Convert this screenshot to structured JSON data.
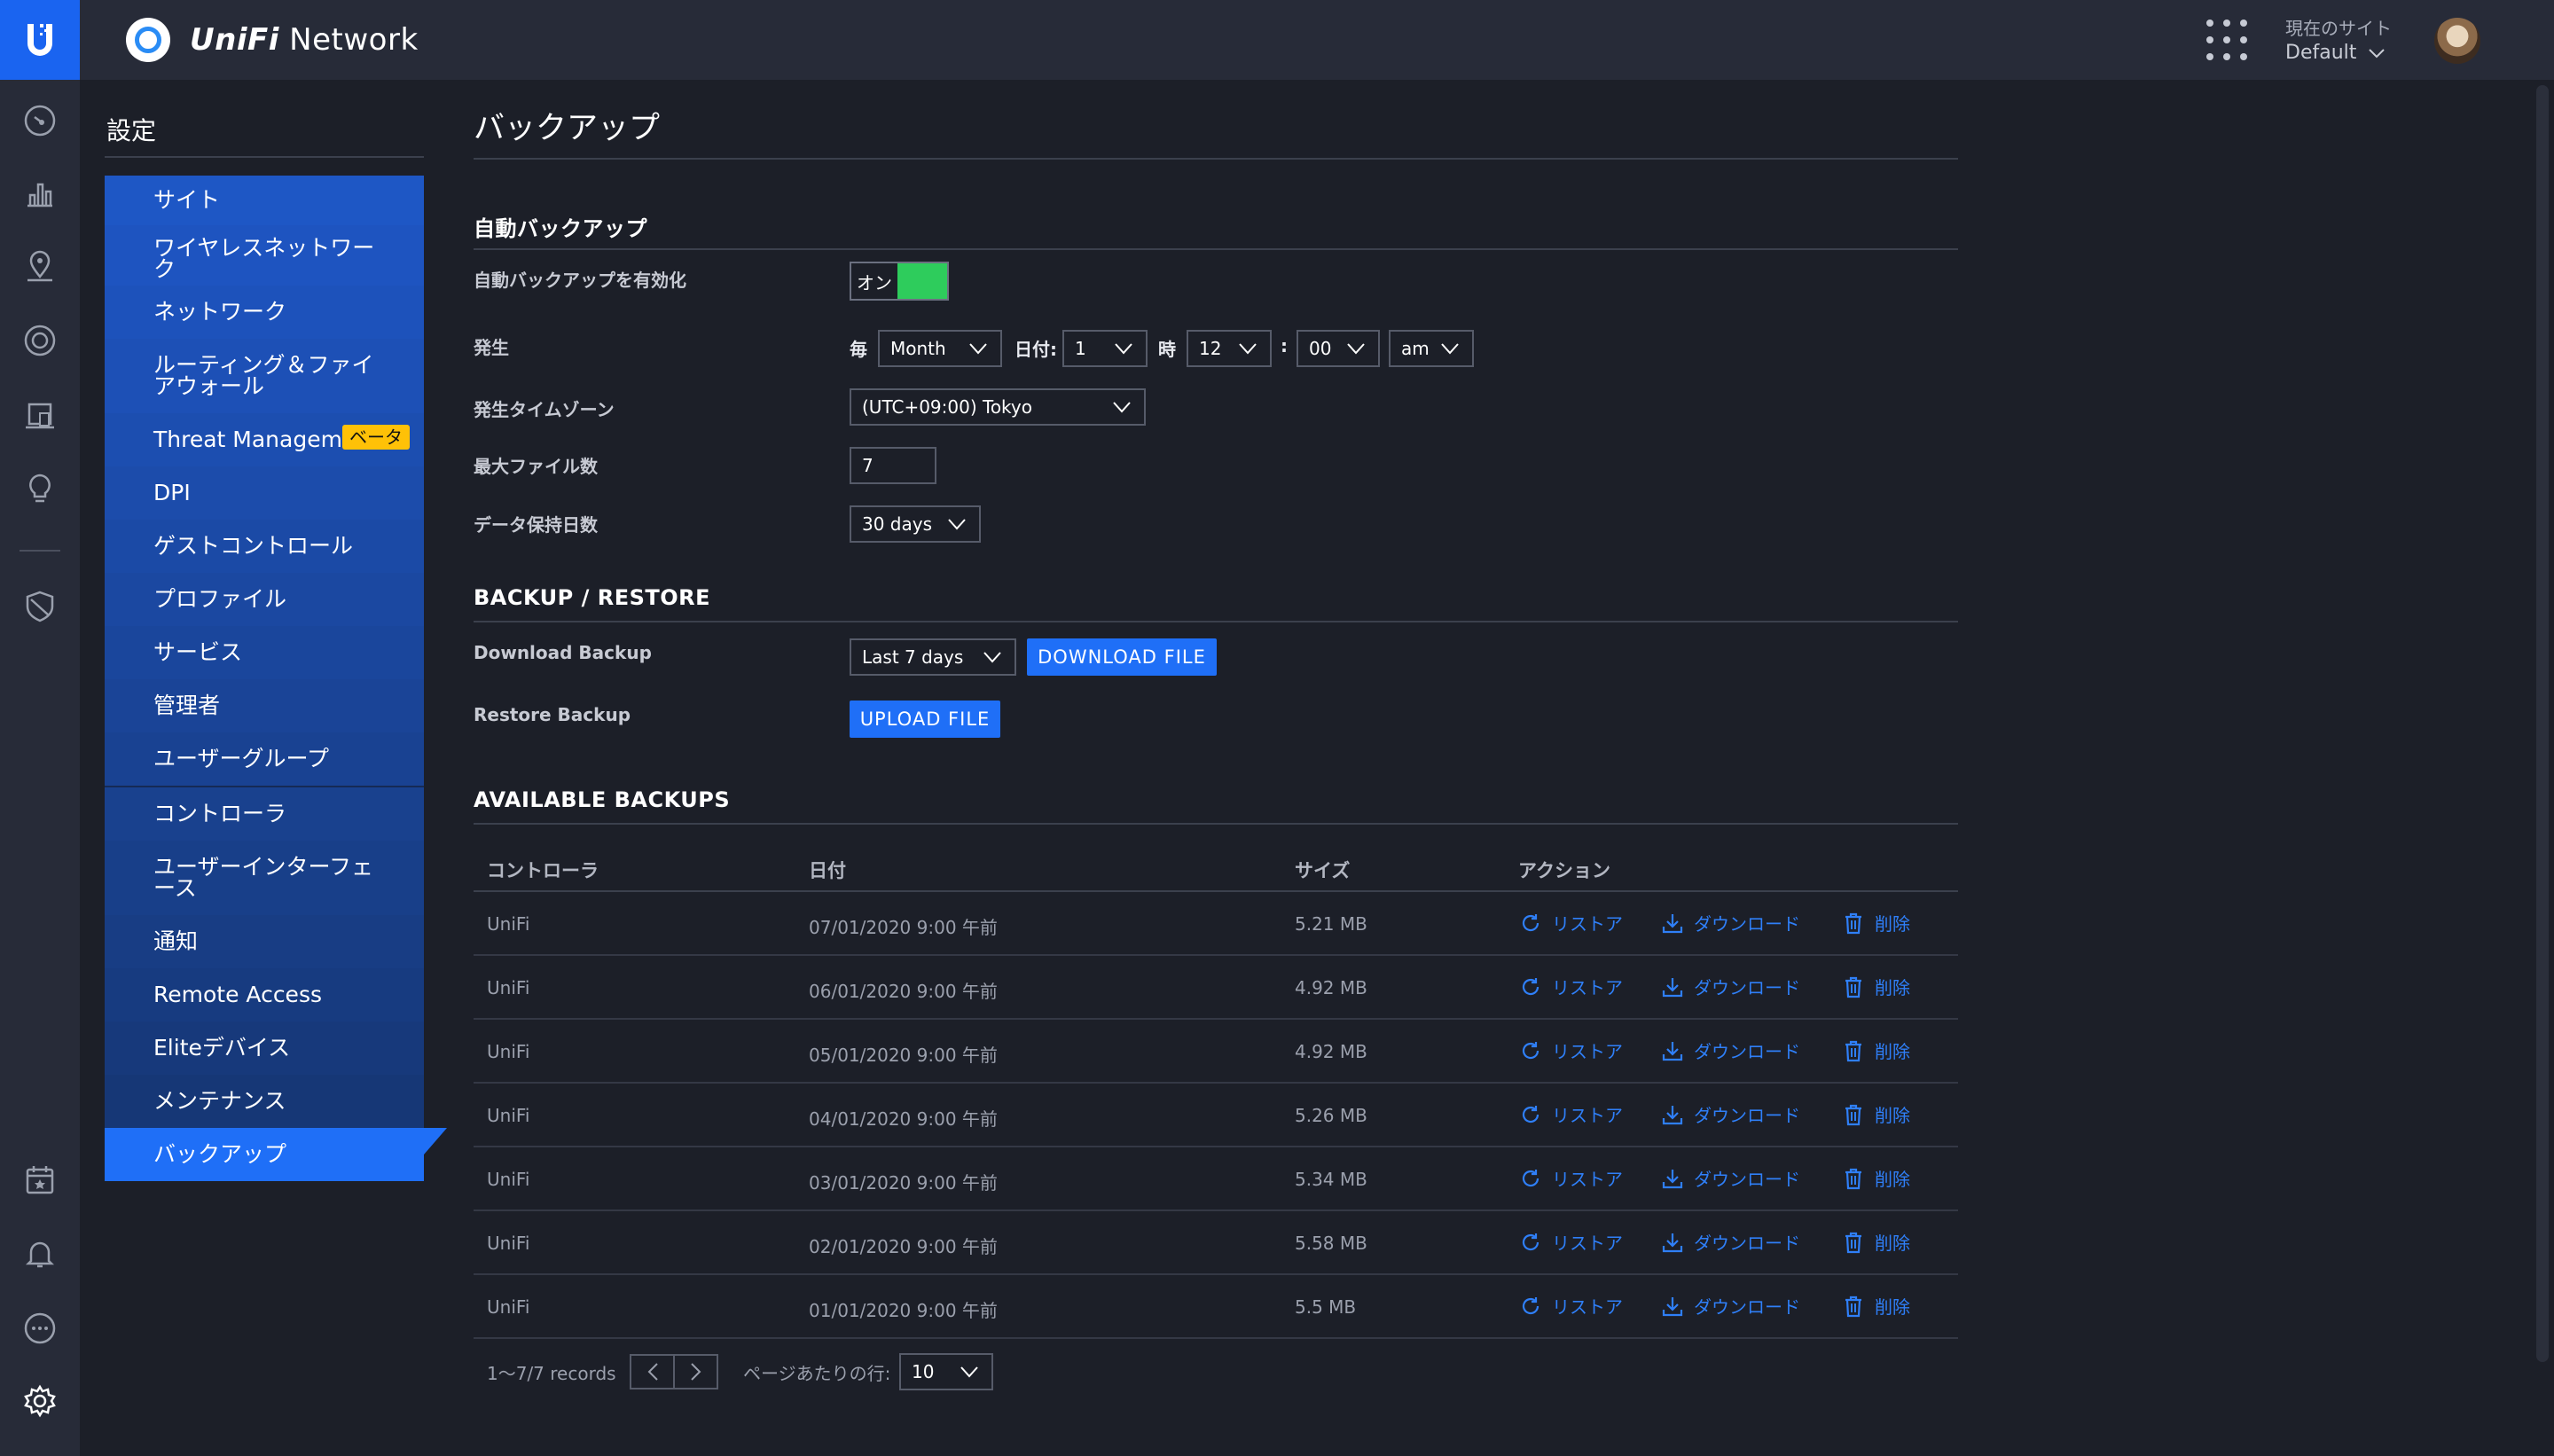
{
  "app": {
    "brand_prefix": "UniFi",
    "brand_suffix": " Network"
  },
  "header": {
    "current_site_label": "現在のサイト",
    "current_site_value": "Default"
  },
  "rail": [
    "dashboard-icon",
    "statistics-icon",
    "map-icon",
    "devices-icon",
    "clients-icon",
    "insights-icon",
    "shield-icon",
    "calendar-icon",
    "bell-icon",
    "chat-icon",
    "gear-icon"
  ],
  "settings": {
    "title": "設定",
    "items": [
      {
        "label": "サイト"
      },
      {
        "label": "ワイヤレスネットワーク"
      },
      {
        "label": "ネットワーク"
      },
      {
        "label": "ルーティング＆ファイアウォール"
      },
      {
        "label": "Threat Managemen",
        "badge": "ベータ"
      },
      {
        "label": "DPI"
      },
      {
        "label": "ゲストコントロール"
      },
      {
        "label": "プロファイル"
      },
      {
        "label": "サービス"
      },
      {
        "label": "管理者"
      },
      {
        "label": "ユーザーグループ"
      },
      {
        "label": "コントローラ"
      },
      {
        "label": "ユーザーインターフェース"
      },
      {
        "label": "通知"
      },
      {
        "label": "Remote Access"
      },
      {
        "label": "Eliteデバイス"
      },
      {
        "label": "メンテナンス"
      },
      {
        "label": "バックアップ"
      }
    ]
  },
  "page": {
    "title": "バックアップ"
  },
  "auto_backup": {
    "section_title": "自動バックアップ",
    "enable_label": "自動バックアップを有効化",
    "enable_state": "オン",
    "occurrence_label": "発生",
    "every_label": "毎",
    "period_value": "Month",
    "date_label": "日付:",
    "date_value": "1",
    "hour_label": "時",
    "hour_value": "12",
    "colon": ":",
    "minute_value": "00",
    "ampm_value": "am",
    "timezone_label": "発生タイムゾーン",
    "timezone_value": "(UTC+09:00) Tokyo",
    "max_files_label": "最大ファイル数",
    "max_files_value": "7",
    "retention_label": "データ保持日数",
    "retention_value": "30 days"
  },
  "backup_restore": {
    "section_title": "BACKUP / RESTORE",
    "download_label": "Download Backup",
    "download_range": "Last 7 days",
    "download_button": "DOWNLOAD FILE",
    "restore_label": "Restore Backup",
    "upload_button": "UPLOAD FILE"
  },
  "available": {
    "section_title": "AVAILABLE BACKUPS",
    "columns": [
      "コントローラ",
      "日付",
      "サイズ",
      "アクション"
    ],
    "actions": {
      "restore": "リストア",
      "download": "ダウンロード",
      "delete": "削除"
    },
    "rows": [
      {
        "controller": "UniFi",
        "date": "07/01/2020 9:00 午前",
        "size": "5.21 MB"
      },
      {
        "controller": "UniFi",
        "date": "06/01/2020 9:00 午前",
        "size": "4.92 MB"
      },
      {
        "controller": "UniFi",
        "date": "05/01/2020 9:00 午前",
        "size": "4.92 MB"
      },
      {
        "controller": "UniFi",
        "date": "04/01/2020 9:00 午前",
        "size": "5.26 MB"
      },
      {
        "controller": "UniFi",
        "date": "03/01/2020 9:00 午前",
        "size": "5.34 MB"
      },
      {
        "controller": "UniFi",
        "date": "02/01/2020 9:00 午前",
        "size": "5.58 MB"
      },
      {
        "controller": "UniFi",
        "date": "01/01/2020 9:00 午前",
        "size": "5.5 MB"
      }
    ],
    "records": "1〜7/7 records",
    "rows_per_page_label": "ページあたりの行:",
    "rows_per_page_value": "10"
  },
  "colors": {
    "accent": "#1f6ff7",
    "toggle_on": "#2ecc5c",
    "beta_badge": "#ffc107",
    "background": "#1c1f28"
  }
}
